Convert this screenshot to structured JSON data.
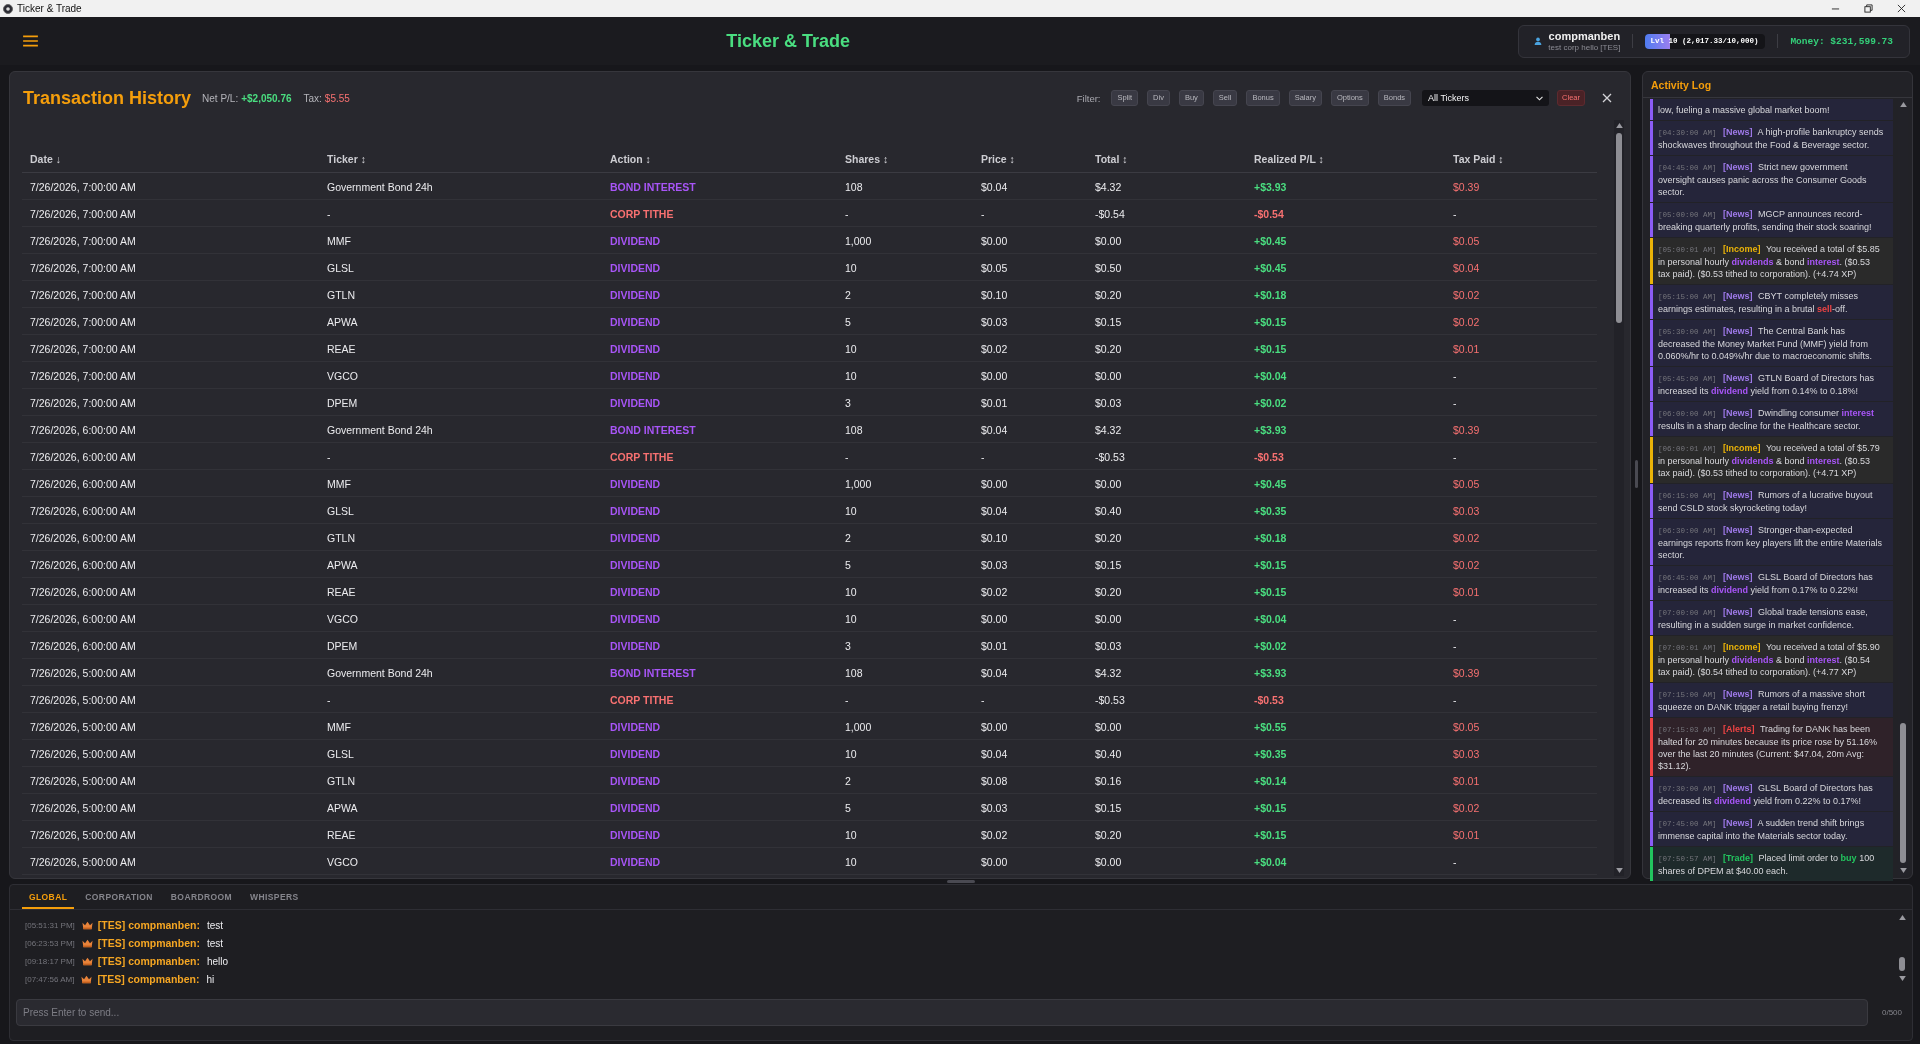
{
  "window": {
    "title": "Ticker & Trade"
  },
  "header": {
    "title": "Ticker & Trade",
    "user": {
      "name": "compmanben",
      "subtitle": "test corp hello [TES]"
    },
    "xp": {
      "label": "Lvl 10 (2,017.33/10,000)",
      "level": 0.2017
    },
    "money": "Money: $231,599.73"
  },
  "transactions": {
    "title": "Transaction History",
    "net_pl_label": "Net P/L:",
    "net_pl": "+$2,050.76",
    "tax_label": "Tax:",
    "tax": "$5.55",
    "filter_label": "Filter:",
    "filters": [
      {
        "label": "Split",
        "selected": false
      },
      {
        "label": "Div",
        "selected": false
      },
      {
        "label": "Buy",
        "selected": false
      },
      {
        "label": "Sell",
        "selected": false
      },
      {
        "label": "Bonus",
        "selected": false
      },
      {
        "label": "Salary",
        "selected": false
      },
      {
        "label": "Options",
        "selected": false
      },
      {
        "label": "Bonds",
        "selected": false
      }
    ],
    "ticker_select": "All Tickers",
    "clear_button": "Clear",
    "columns": [
      {
        "label": "Date",
        "sort": "↓"
      },
      {
        "label": "Ticker",
        "sort": "↕"
      },
      {
        "label": "Action",
        "sort": "↕"
      },
      {
        "label": "Shares",
        "sort": "↕"
      },
      {
        "label": "Price",
        "sort": "↕"
      },
      {
        "label": "Total",
        "sort": "↕"
      },
      {
        "label": "Realized P/L",
        "sort": "↕"
      },
      {
        "label": "Tax Paid",
        "sort": "↕"
      }
    ],
    "rows": [
      {
        "date": "7/26/2026, 7:00:00 AM",
        "ticker": "Government Bond 24h",
        "action": {
          "text": "BOND INTEREST",
          "kind": "income"
        },
        "shares": "108",
        "price": "$0.04",
        "total": "$4.32",
        "realized_pl": {
          "text": "+$3.93",
          "kind": "gain"
        },
        "tax_paid": {
          "text": "$0.39",
          "kind": "paid"
        }
      },
      {
        "date": "7/26/2026, 7:00:00 AM",
        "ticker": "-",
        "action": {
          "text": "CORP TITHE",
          "kind": "tithe"
        },
        "shares": "-",
        "price": "-",
        "total": "-$0.54",
        "realized_pl": {
          "text": "-$0.54",
          "kind": "loss"
        },
        "tax_paid": {
          "text": "-",
          "kind": "none"
        }
      },
      {
        "date": "7/26/2026, 7:00:00 AM",
        "ticker": "MMF",
        "action": {
          "text": "DIVIDEND",
          "kind": "income"
        },
        "shares": "1,000",
        "price": "$0.00",
        "total": "$0.00",
        "realized_pl": {
          "text": "+$0.45",
          "kind": "gain"
        },
        "tax_paid": {
          "text": "$0.05",
          "kind": "paid"
        }
      },
      {
        "date": "7/26/2026, 7:00:00 AM",
        "ticker": "GLSL",
        "action": {
          "text": "DIVIDEND",
          "kind": "income"
        },
        "shares": "10",
        "price": "$0.05",
        "total": "$0.50",
        "realized_pl": {
          "text": "+$0.45",
          "kind": "gain"
        },
        "tax_paid": {
          "text": "$0.04",
          "kind": "paid"
        }
      },
      {
        "date": "7/26/2026, 7:00:00 AM",
        "ticker": "GTLN",
        "action": {
          "text": "DIVIDEND",
          "kind": "income"
        },
        "shares": "2",
        "price": "$0.10",
        "total": "$0.20",
        "realized_pl": {
          "text": "+$0.18",
          "kind": "gain"
        },
        "tax_paid": {
          "text": "$0.02",
          "kind": "paid"
        }
      },
      {
        "date": "7/26/2026, 7:00:00 AM",
        "ticker": "APWA",
        "action": {
          "text": "DIVIDEND",
          "kind": "income"
        },
        "shares": "5",
        "price": "$0.03",
        "total": "$0.15",
        "realized_pl": {
          "text": "+$0.15",
          "kind": "gain"
        },
        "tax_paid": {
          "text": "$0.02",
          "kind": "paid"
        }
      },
      {
        "date": "7/26/2026, 7:00:00 AM",
        "ticker": "REAE",
        "action": {
          "text": "DIVIDEND",
          "kind": "income"
        },
        "shares": "10",
        "price": "$0.02",
        "total": "$0.20",
        "realized_pl": {
          "text": "+$0.15",
          "kind": "gain"
        },
        "tax_paid": {
          "text": "$0.01",
          "kind": "paid"
        }
      },
      {
        "date": "7/26/2026, 7:00:00 AM",
        "ticker": "VGCO",
        "action": {
          "text": "DIVIDEND",
          "kind": "income"
        },
        "shares": "10",
        "price": "$0.00",
        "total": "$0.00",
        "realized_pl": {
          "text": "+$0.04",
          "kind": "gain"
        },
        "tax_paid": {
          "text": "-",
          "kind": "none"
        }
      },
      {
        "date": "7/26/2026, 7:00:00 AM",
        "ticker": "DPEM",
        "action": {
          "text": "DIVIDEND",
          "kind": "income"
        },
        "shares": "3",
        "price": "$0.01",
        "total": "$0.03",
        "realized_pl": {
          "text": "+$0.02",
          "kind": "gain"
        },
        "tax_paid": {
          "text": "-",
          "kind": "none"
        }
      },
      {
        "date": "7/26/2026, 6:00:00 AM",
        "ticker": "Government Bond 24h",
        "action": {
          "text": "BOND INTEREST",
          "kind": "income"
        },
        "shares": "108",
        "price": "$0.04",
        "total": "$4.32",
        "realized_pl": {
          "text": "+$3.93",
          "kind": "gain"
        },
        "tax_paid": {
          "text": "$0.39",
          "kind": "paid"
        }
      },
      {
        "date": "7/26/2026, 6:00:00 AM",
        "ticker": "-",
        "action": {
          "text": "CORP TITHE",
          "kind": "tithe"
        },
        "shares": "-",
        "price": "-",
        "total": "-$0.53",
        "realized_pl": {
          "text": "-$0.53",
          "kind": "loss"
        },
        "tax_paid": {
          "text": "-",
          "kind": "none"
        }
      },
      {
        "date": "7/26/2026, 6:00:00 AM",
        "ticker": "MMF",
        "action": {
          "text": "DIVIDEND",
          "kind": "income"
        },
        "shares": "1,000",
        "price": "$0.00",
        "total": "$0.00",
        "realized_pl": {
          "text": "+$0.45",
          "kind": "gain"
        },
        "tax_paid": {
          "text": "$0.05",
          "kind": "paid"
        }
      },
      {
        "date": "7/26/2026, 6:00:00 AM",
        "ticker": "GLSL",
        "action": {
          "text": "DIVIDEND",
          "kind": "income"
        },
        "shares": "10",
        "price": "$0.04",
        "total": "$0.40",
        "realized_pl": {
          "text": "+$0.35",
          "kind": "gain"
        },
        "tax_paid": {
          "text": "$0.03",
          "kind": "paid"
        }
      },
      {
        "date": "7/26/2026, 6:00:00 AM",
        "ticker": "GTLN",
        "action": {
          "text": "DIVIDEND",
          "kind": "income"
        },
        "shares": "2",
        "price": "$0.10",
        "total": "$0.20",
        "realized_pl": {
          "text": "+$0.18",
          "kind": "gain"
        },
        "tax_paid": {
          "text": "$0.02",
          "kind": "paid"
        }
      },
      {
        "date": "7/26/2026, 6:00:00 AM",
        "ticker": "APWA",
        "action": {
          "text": "DIVIDEND",
          "kind": "income"
        },
        "shares": "5",
        "price": "$0.03",
        "total": "$0.15",
        "realized_pl": {
          "text": "+$0.15",
          "kind": "gain"
        },
        "tax_paid": {
          "text": "$0.02",
          "kind": "paid"
        }
      },
      {
        "date": "7/26/2026, 6:00:00 AM",
        "ticker": "REAE",
        "action": {
          "text": "DIVIDEND",
          "kind": "income"
        },
        "shares": "10",
        "price": "$0.02",
        "total": "$0.20",
        "realized_pl": {
          "text": "+$0.15",
          "kind": "gain"
        },
        "tax_paid": {
          "text": "$0.01",
          "kind": "paid"
        }
      },
      {
        "date": "7/26/2026, 6:00:00 AM",
        "ticker": "VGCO",
        "action": {
          "text": "DIVIDEND",
          "kind": "income"
        },
        "shares": "10",
        "price": "$0.00",
        "total": "$0.00",
        "realized_pl": {
          "text": "+$0.04",
          "kind": "gain"
        },
        "tax_paid": {
          "text": "-",
          "kind": "none"
        }
      },
      {
        "date": "7/26/2026, 6:00:00 AM",
        "ticker": "DPEM",
        "action": {
          "text": "DIVIDEND",
          "kind": "income"
        },
        "shares": "3",
        "price": "$0.01",
        "total": "$0.03",
        "realized_pl": {
          "text": "+$0.02",
          "kind": "gain"
        },
        "tax_paid": {
          "text": "-",
          "kind": "none"
        }
      },
      {
        "date": "7/26/2026, 5:00:00 AM",
        "ticker": "Government Bond 24h",
        "action": {
          "text": "BOND INTEREST",
          "kind": "income"
        },
        "shares": "108",
        "price": "$0.04",
        "total": "$4.32",
        "realized_pl": {
          "text": "+$3.93",
          "kind": "gain"
        },
        "tax_paid": {
          "text": "$0.39",
          "kind": "paid"
        }
      },
      {
        "date": "7/26/2026, 5:00:00 AM",
        "ticker": "-",
        "action": {
          "text": "CORP TITHE",
          "kind": "tithe"
        },
        "shares": "-",
        "price": "-",
        "total": "-$0.53",
        "realized_pl": {
          "text": "-$0.53",
          "kind": "loss"
        },
        "tax_paid": {
          "text": "-",
          "kind": "none"
        }
      },
      {
        "date": "7/26/2026, 5:00:00 AM",
        "ticker": "MMF",
        "action": {
          "text": "DIVIDEND",
          "kind": "income"
        },
        "shares": "1,000",
        "price": "$0.00",
        "total": "$0.00",
        "realized_pl": {
          "text": "+$0.55",
          "kind": "gain"
        },
        "tax_paid": {
          "text": "$0.05",
          "kind": "paid"
        }
      },
      {
        "date": "7/26/2026, 5:00:00 AM",
        "ticker": "GLSL",
        "action": {
          "text": "DIVIDEND",
          "kind": "income"
        },
        "shares": "10",
        "price": "$0.04",
        "total": "$0.40",
        "realized_pl": {
          "text": "+$0.35",
          "kind": "gain"
        },
        "tax_paid": {
          "text": "$0.03",
          "kind": "paid"
        }
      },
      {
        "date": "7/26/2026, 5:00:00 AM",
        "ticker": "GTLN",
        "action": {
          "text": "DIVIDEND",
          "kind": "income"
        },
        "shares": "2",
        "price": "$0.08",
        "total": "$0.16",
        "realized_pl": {
          "text": "+$0.14",
          "kind": "gain"
        },
        "tax_paid": {
          "text": "$0.01",
          "kind": "paid"
        }
      },
      {
        "date": "7/26/2026, 5:00:00 AM",
        "ticker": "APWA",
        "action": {
          "text": "DIVIDEND",
          "kind": "income"
        },
        "shares": "5",
        "price": "$0.03",
        "total": "$0.15",
        "realized_pl": {
          "text": "+$0.15",
          "kind": "gain"
        },
        "tax_paid": {
          "text": "$0.02",
          "kind": "paid"
        }
      },
      {
        "date": "7/26/2026, 5:00:00 AM",
        "ticker": "REAE",
        "action": {
          "text": "DIVIDEND",
          "kind": "income"
        },
        "shares": "10",
        "price": "$0.02",
        "total": "$0.20",
        "realized_pl": {
          "text": "+$0.15",
          "kind": "gain"
        },
        "tax_paid": {
          "text": "$0.01",
          "kind": "paid"
        }
      },
      {
        "date": "7/26/2026, 5:00:00 AM",
        "ticker": "VGCO",
        "action": {
          "text": "DIVIDEND",
          "kind": "income"
        },
        "shares": "10",
        "price": "$0.00",
        "total": "$0.00",
        "realized_pl": {
          "text": "+$0.04",
          "kind": "gain"
        },
        "tax_paid": {
          "text": "-",
          "kind": "none"
        }
      }
    ]
  },
  "activity_log": {
    "title": "Activity Log",
    "entries": [
      {
        "kind": "news",
        "parts": [
          {
            "text": "low, fueling a massive global market boom!",
            "kind": "plain"
          }
        ]
      },
      {
        "kind": "news",
        "time": "[04:30:00 AM]",
        "tag": "[News]",
        "parts": [
          {
            "text": "A high-profile bankruptcy sends shockwaves throughout the Food & Beverage sector.",
            "kind": "plain"
          }
        ]
      },
      {
        "kind": "news",
        "time": "[04:45:00 AM]",
        "tag": "[News]",
        "parts": [
          {
            "text": "Strict new government oversight causes panic across the Consumer Goods sector.",
            "kind": "plain"
          }
        ]
      },
      {
        "kind": "news",
        "time": "[05:00:00 AM]",
        "tag": "[News]",
        "parts": [
          {
            "text": "MGCP announces record-breaking quarterly profits, sending their stock soaring!",
            "kind": "plain"
          }
        ]
      },
      {
        "kind": "income",
        "time": "[05:00:01 AM]",
        "tag": "[Income]",
        "parts": [
          {
            "text": "You received a total of $5.85 in personal hourly ",
            "kind": "plain"
          },
          {
            "text": "dividends",
            "kind": "term"
          },
          {
            "text": " & bond ",
            "kind": "plain"
          },
          {
            "text": "interest",
            "kind": "term"
          },
          {
            "text": ". ($0.53 tax paid). ($0.53 tithed to corporation). (+4.74 XP)",
            "kind": "plain"
          }
        ]
      },
      {
        "kind": "news",
        "time": "[05:15:00 AM]",
        "tag": "[News]",
        "parts": [
          {
            "text": "CBYT completely misses earnings estimates, resulting in a brutal ",
            "kind": "plain"
          },
          {
            "text": "sell",
            "kind": "sell"
          },
          {
            "text": "-off.",
            "kind": "plain"
          }
        ]
      },
      {
        "kind": "news",
        "time": "[05:30:00 AM]",
        "tag": "[News]",
        "parts": [
          {
            "text": "The Central Bank has decreased the Money Market Fund (MMF) yield from 0.060%/hr to 0.049%/hr due to macroeconomic shifts.",
            "kind": "plain"
          }
        ]
      },
      {
        "kind": "news",
        "time": "[05:45:00 AM]",
        "tag": "[News]",
        "parts": [
          {
            "text": "GTLN Board of Directors has increased its ",
            "kind": "plain"
          },
          {
            "text": "dividend",
            "kind": "term"
          },
          {
            "text": " yield from 0.14% to 0.18%!",
            "kind": "plain"
          }
        ]
      },
      {
        "kind": "news",
        "time": "[06:00:00 AM]",
        "tag": "[News]",
        "parts": [
          {
            "text": "Dwindling consumer ",
            "kind": "plain"
          },
          {
            "text": "interest",
            "kind": "term"
          },
          {
            "text": " results in a sharp decline for the Healthcare sector.",
            "kind": "plain"
          }
        ]
      },
      {
        "kind": "income",
        "time": "[06:00:01 AM]",
        "tag": "[Income]",
        "parts": [
          {
            "text": "You received a total of $5.79 in personal hourly ",
            "kind": "plain"
          },
          {
            "text": "dividends",
            "kind": "term"
          },
          {
            "text": " & bond ",
            "kind": "plain"
          },
          {
            "text": "interest",
            "kind": "term"
          },
          {
            "text": ". ($0.53 tax paid). ($0.53 tithed to corporation). (+4.71 XP)",
            "kind": "plain"
          }
        ]
      },
      {
        "kind": "news",
        "time": "[06:15:00 AM]",
        "tag": "[News]",
        "parts": [
          {
            "text": "Rumors of a lucrative buyout send CSLD stock skyrocketing today!",
            "kind": "plain"
          }
        ]
      },
      {
        "kind": "news",
        "time": "[06:30:00 AM]",
        "tag": "[News]",
        "parts": [
          {
            "text": "Stronger-than-expected earnings reports from key players lift the entire Materials sector.",
            "kind": "plain"
          }
        ]
      },
      {
        "kind": "news",
        "time": "[06:45:00 AM]",
        "tag": "[News]",
        "parts": [
          {
            "text": "GLSL Board of Directors has increased its ",
            "kind": "plain"
          },
          {
            "text": "dividend",
            "kind": "term"
          },
          {
            "text": " yield from 0.17% to 0.22%!",
            "kind": "plain"
          }
        ]
      },
      {
        "kind": "news",
        "time": "[07:00:00 AM]",
        "tag": "[News]",
        "parts": [
          {
            "text": "Global trade tensions ease, resulting in a sudden surge in market confidence.",
            "kind": "plain"
          }
        ]
      },
      {
        "kind": "income",
        "time": "[07:00:01 AM]",
        "tag": "[Income]",
        "parts": [
          {
            "text": "You received a total of $5.90 in personal hourly ",
            "kind": "plain"
          },
          {
            "text": "dividends",
            "kind": "term"
          },
          {
            "text": " & bond ",
            "kind": "plain"
          },
          {
            "text": "interest",
            "kind": "term"
          },
          {
            "text": ". ($0.54 tax paid). ($0.54 tithed to corporation). (+4.77 XP)",
            "kind": "plain"
          }
        ]
      },
      {
        "kind": "news",
        "time": "[07:15:00 AM]",
        "tag": "[News]",
        "parts": [
          {
            "text": "Rumors of a massive short squeeze on DANK trigger a retail buying frenzy!",
            "kind": "plain"
          }
        ]
      },
      {
        "kind": "alert",
        "time": "[07:15:03 AM]",
        "tag": "[Alerts]",
        "parts": [
          {
            "text": "Trading for DANK has been halted for 20 minutes because its price rose by 51.16% over the last 20 minutes (Current: $47.04, 20m Avg: $31.12).",
            "kind": "plain"
          }
        ]
      },
      {
        "kind": "news",
        "time": "[07:30:00 AM]",
        "tag": "[News]",
        "parts": [
          {
            "text": "GLSL Board of Directors has decreased its ",
            "kind": "plain"
          },
          {
            "text": "dividend",
            "kind": "term"
          },
          {
            "text": " yield from 0.22% to 0.17%!",
            "kind": "plain"
          }
        ]
      },
      {
        "kind": "news",
        "time": "[07:45:00 AM]",
        "tag": "[News]",
        "parts": [
          {
            "text": "A sudden trend shift brings immense capital into the Materials sector today.",
            "kind": "plain"
          }
        ]
      },
      {
        "kind": "trade",
        "time": "[07:50:57 AM]",
        "tag": "[Trade]",
        "parts": [
          {
            "text": "Placed limit order to ",
            "kind": "plain"
          },
          {
            "text": "buy",
            "kind": "buy"
          },
          {
            "text": " 100 shares of DPEM at $40.00 each.",
            "kind": "plain"
          }
        ]
      }
    ]
  },
  "chat": {
    "tabs": [
      {
        "label": "GLOBAL",
        "selected": true
      },
      {
        "label": "CORPORATION",
        "selected": false
      },
      {
        "label": "BOARDROOM",
        "selected": false
      },
      {
        "label": "WHISPERS",
        "selected": false
      }
    ],
    "messages": [
      {
        "time": "[05:51:31 PM]",
        "sender": "[TES] compmanben:",
        "text": "test"
      },
      {
        "time": "[06:23:53 PM]",
        "sender": "[TES] compmanben:",
        "text": "test"
      },
      {
        "time": "[09:18:17 PM]",
        "sender": "[TES] compmanben:",
        "text": "hello"
      },
      {
        "time": "[07:47:56 AM]",
        "sender": "[TES] compmanben:",
        "text": "hi"
      }
    ],
    "input": {
      "placeholder": "Press Enter to send..."
    },
    "counter": "0/500"
  }
}
